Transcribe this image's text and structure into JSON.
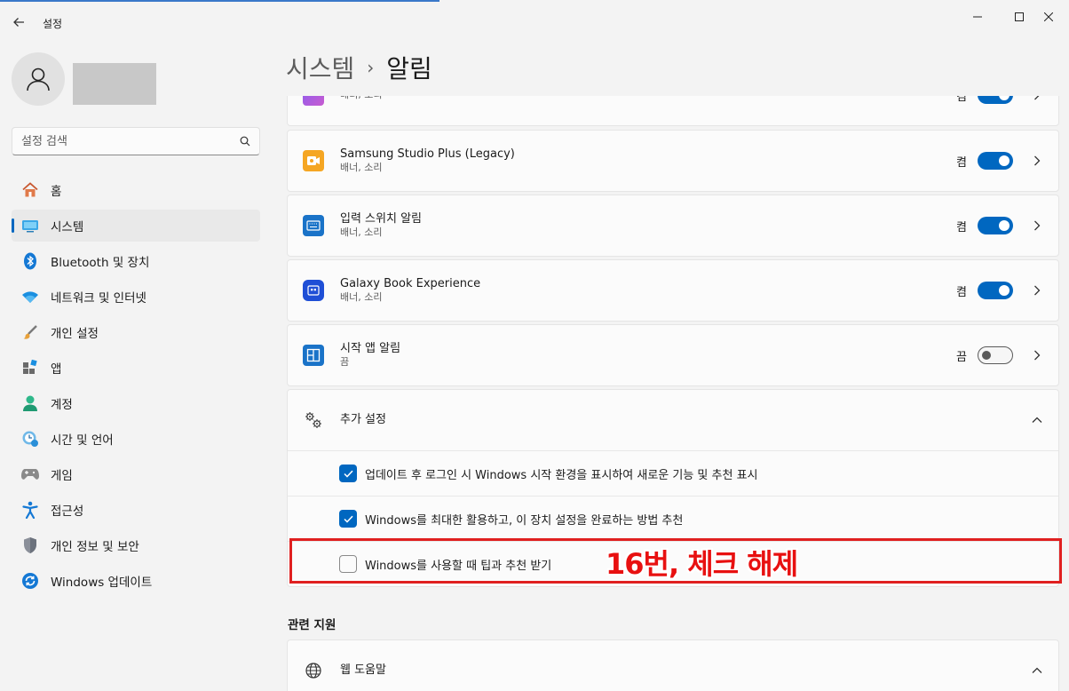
{
  "window": {
    "title": "설정"
  },
  "user": {
    "avatar_icon": "person-icon"
  },
  "search": {
    "placeholder": "설정 검색"
  },
  "sidebar": {
    "items": [
      {
        "label": "홈",
        "icon": "home-icon"
      },
      {
        "label": "시스템",
        "icon": "system-icon",
        "active": true
      },
      {
        "label": "Bluetooth 및 장치",
        "icon": "bluetooth-icon"
      },
      {
        "label": "네트워크 및 인터넷",
        "icon": "wifi-icon"
      },
      {
        "label": "개인 설정",
        "icon": "brush-icon"
      },
      {
        "label": "앱",
        "icon": "apps-icon"
      },
      {
        "label": "계정",
        "icon": "account-icon"
      },
      {
        "label": "시간 및 언어",
        "icon": "clock-globe-icon"
      },
      {
        "label": "게임",
        "icon": "gamepad-icon"
      },
      {
        "label": "접근성",
        "icon": "accessibility-icon"
      },
      {
        "label": "개인 정보 및 보안",
        "icon": "shield-icon"
      },
      {
        "label": "Windows 업데이트",
        "icon": "update-icon"
      }
    ]
  },
  "breadcrumb": {
    "parent": "시스템",
    "separator": "›",
    "current": "알림"
  },
  "apps": [
    {
      "name": "",
      "sub": "배너, 소리",
      "state": "켬",
      "on": true,
      "icon": "purple-app-icon",
      "partial": true
    },
    {
      "name": "Samsung Studio Plus (Legacy)",
      "sub": "배너, 소리",
      "state": "켬",
      "on": true,
      "icon": "studio-plus-icon"
    },
    {
      "name": "입력 스위치 알림",
      "sub": "배너, 소리",
      "state": "켬",
      "on": true,
      "icon": "keyboard-icon"
    },
    {
      "name": "Galaxy Book Experience",
      "sub": "배너, 소리",
      "state": "켬",
      "on": true,
      "icon": "galaxy-book-icon"
    },
    {
      "name": "시작 앱 알림",
      "sub": "끔",
      "state": "끔",
      "on": false,
      "icon": "start-app-icon"
    }
  ],
  "additional": {
    "title": "추가 설정",
    "icon": "gears-icon",
    "options": [
      {
        "label": "업데이트 후 로그인 시 Windows 시작 환경을 표시하여 새로운 기능 및 추천 표시",
        "checked": true
      },
      {
        "label": "Windows를 최대한 활용하고, 이 장치 설정을 완료하는 방법 추천",
        "checked": true
      },
      {
        "label": "Windows를 사용할 때 팁과 추천 받기",
        "checked": false
      }
    ]
  },
  "annotation": {
    "text": "16번, 체크 해제",
    "color": "#e81010"
  },
  "related": {
    "title": "관련 지원",
    "web_help": "웹 도움말"
  },
  "colors": {
    "accent": "#0067c0",
    "highlight": "#e02020"
  }
}
